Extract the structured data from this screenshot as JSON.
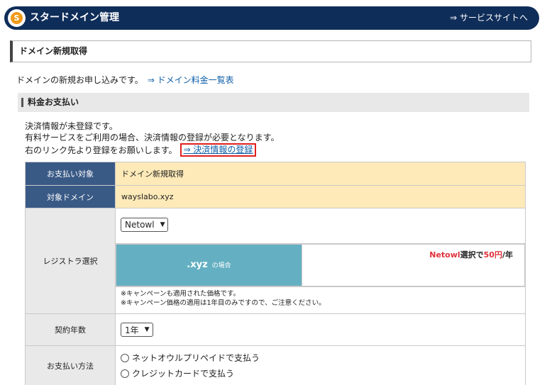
{
  "header": {
    "logo_letter": "S",
    "app_title": "スタードメイン管理",
    "service_link": "⇒ サービスサイトへ"
  },
  "page": {
    "title": "ドメイン新規取得",
    "intro_text": "ドメインの新規お申し込みです。",
    "price_list_link": "⇒ ドメイン料金一覧表"
  },
  "section": {
    "title": "料金お支払い",
    "notice_line1": "決済情報が未登録です。",
    "notice_line2": "有料サービスをご利用の場合、決済情報の登録が必要となります。",
    "notice_line3": "右のリンク先より登録をお願いします。",
    "payment_link": "⇒ 決済情報の登録"
  },
  "form": {
    "payment_target_label": "お支払い対象",
    "payment_target_value": "ドメイン新規取得",
    "target_domain_label": "対象ドメイン",
    "target_domain_value": "wayslabo.xyz",
    "registrar_label": "レジストラ選択",
    "registrar_selected": "Netowl",
    "tld": ".xyz",
    "tld_suffix": "の場合",
    "price_registrar": "Netowl",
    "price_select_text": "選択で",
    "price_amount": "50円",
    "price_unit": "/年",
    "note1": "※キャンペーンも適用された価格です。",
    "note2": "※キャンペーン価格の適用は1年目のみですので、ご注意ください。",
    "years_label": "契約年数",
    "years_selected": "1年",
    "method_label": "お支払い方法",
    "method_option1": "ネットオウルプリペイドで支払う",
    "method_option2": "クレジットカードで支払う"
  },
  "colors": {
    "header_bg": "#0f2d59",
    "label_dark": "#3a5a86",
    "label_gray": "#e9e9e9",
    "value_yellow": "#feeab8",
    "tld_bg": "#64b0c2",
    "highlight_red": "#e0201e",
    "link": "#1060a8"
  }
}
